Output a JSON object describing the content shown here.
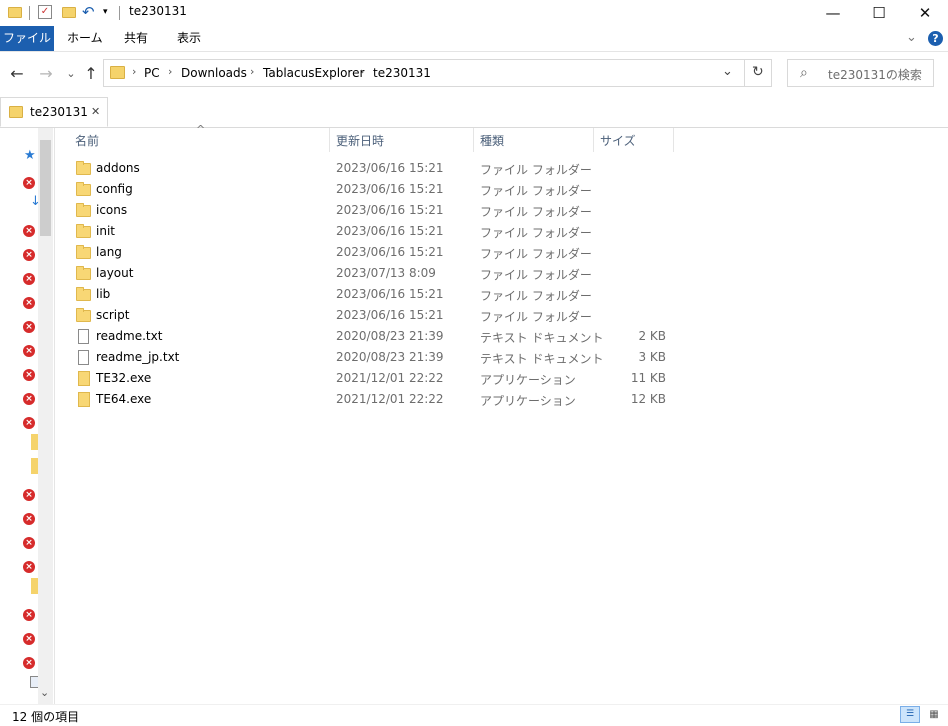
{
  "window": {
    "title": "te230131",
    "minimize_glyph": "—",
    "maximize_glyph": "☐",
    "close_glyph": "✕"
  },
  "ribbon": {
    "tabs": [
      "ファイル",
      "ホーム",
      "共有",
      "表示"
    ],
    "expand_glyph": "⌄",
    "help_glyph": "?"
  },
  "nav": {
    "back_glyph": "←",
    "forward_glyph": "→",
    "recent_glyph": "⌄",
    "up_glyph": "↑",
    "refresh_glyph": "↻",
    "dropdown_glyph": "⌄"
  },
  "breadcrumb": [
    "PC",
    "Downloads",
    "TablacusExplorer",
    "te230131"
  ],
  "breadcrumb_sep": "›",
  "search": {
    "placeholder": "te230131の検索",
    "icon_glyph": "⌕"
  },
  "tabs": [
    {
      "label": "te230131",
      "close_glyph": "✕"
    }
  ],
  "list": {
    "columns": [
      "名前",
      "更新日時",
      "種類",
      "サイズ"
    ],
    "sort_glyph": "^",
    "rows": [
      {
        "name": "addons",
        "modified": "2023/06/16 15:21",
        "type": "ファイル フォルダー",
        "size": "",
        "icon": "folder-icon"
      },
      {
        "name": "config",
        "modified": "2023/06/16 15:21",
        "type": "ファイル フォルダー",
        "size": "",
        "icon": "folder-icon"
      },
      {
        "name": "icons",
        "modified": "2023/06/16 15:21",
        "type": "ファイル フォルダー",
        "size": "",
        "icon": "folder-icon"
      },
      {
        "name": "init",
        "modified": "2023/06/16 15:21",
        "type": "ファイル フォルダー",
        "size": "",
        "icon": "folder-icon"
      },
      {
        "name": "lang",
        "modified": "2023/06/16 15:21",
        "type": "ファイル フォルダー",
        "size": "",
        "icon": "folder-icon"
      },
      {
        "name": "layout",
        "modified": "2023/07/13 8:09",
        "type": "ファイル フォルダー",
        "size": "",
        "icon": "folder-icon"
      },
      {
        "name": "lib",
        "modified": "2023/06/16 15:21",
        "type": "ファイル フォルダー",
        "size": "",
        "icon": "folder-icon"
      },
      {
        "name": "script",
        "modified": "2023/06/16 15:21",
        "type": "ファイル フォルダー",
        "size": "",
        "icon": "folder-icon"
      },
      {
        "name": "readme.txt",
        "modified": "2020/08/23 21:39",
        "type": "テキスト ドキュメント",
        "size": "2 KB",
        "icon": "text-file-icon"
      },
      {
        "name": "readme_jp.txt",
        "modified": "2020/08/23 21:39",
        "type": "テキスト ドキュメント",
        "size": "3 KB",
        "icon": "text-file-icon"
      },
      {
        "name": "TE32.exe",
        "modified": "2021/12/01 22:22",
        "type": "アプリケーション",
        "size": "11 KB",
        "icon": "exe-icon"
      },
      {
        "name": "TE64.exe",
        "modified": "2021/12/01 22:22",
        "type": "アプリケーション",
        "size": "12 KB",
        "icon": "exe-icon"
      }
    ]
  },
  "tree": {
    "scroll_down_glyph": "⌄"
  },
  "status": {
    "item_count": "12 個の項目"
  },
  "colors": {
    "accent": "#1c5faf",
    "folder": "#f8d775",
    "error": "#d62b2b"
  }
}
